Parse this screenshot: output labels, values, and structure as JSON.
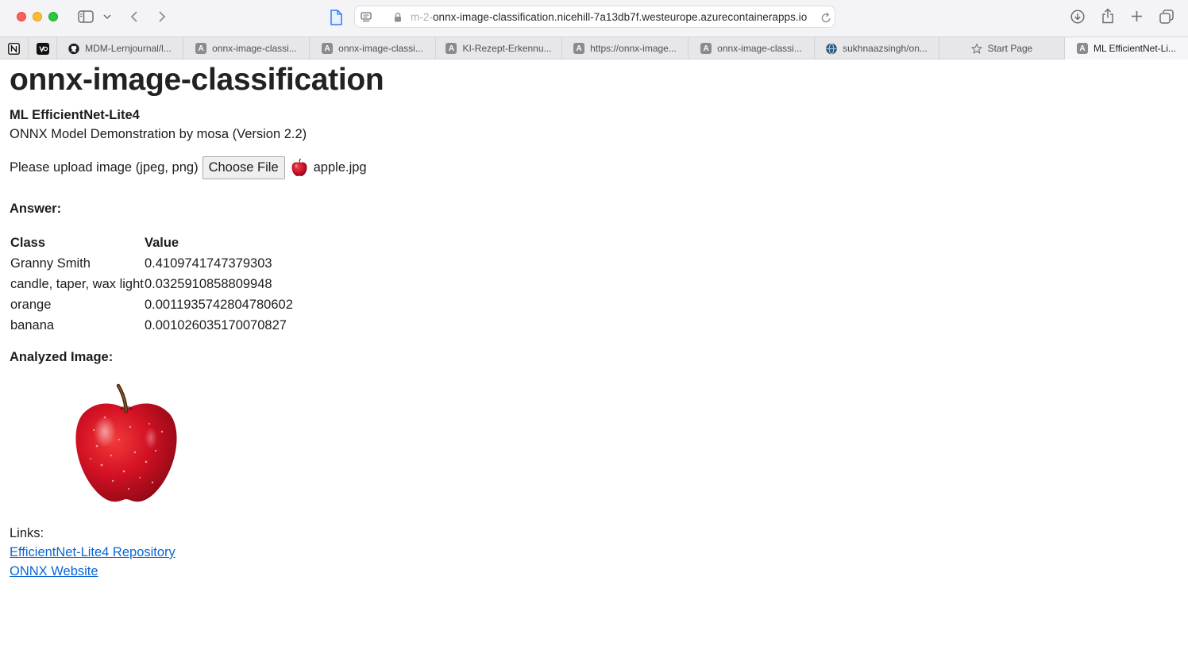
{
  "browser": {
    "url_prefix": "m-2-",
    "url": "onnx-image-classification.nicehill-7a13db7f.westeurope.azurecontainerapps.io",
    "pinned_tabs": [
      {
        "icon": "notion-icon"
      },
      {
        "icon": "vercel-icon"
      }
    ],
    "tabs": [
      {
        "label": "MDM-Lernjournal/l...",
        "icon": "github-icon"
      },
      {
        "label": "onnx-image-classi...",
        "icon": "letter-a-icon"
      },
      {
        "label": "onnx-image-classi...",
        "icon": "letter-a-icon"
      },
      {
        "label": "KI-Rezept-Erkennu...",
        "icon": "letter-a-icon"
      },
      {
        "label": "https://onnx-image...",
        "icon": "letter-a-icon"
      },
      {
        "label": "onnx-image-classi...",
        "icon": "letter-a-icon"
      },
      {
        "label": "sukhnaazsingh/on...",
        "icon": "globe-icon"
      },
      {
        "label": "Start Page",
        "icon": "star-icon"
      },
      {
        "label": "ML EfficientNet-Li...",
        "icon": "letter-a-icon",
        "active": true
      }
    ]
  },
  "page": {
    "title": "onnx-image-classification",
    "subtitle": "ML EfficientNet-Lite4",
    "demo_line": "ONNX Model Demonstration by mosa (Version 2.2)",
    "upload_label": "Please upload image (jpeg, png)",
    "choose_file_label": "Choose File",
    "file_name": "apple.jpg",
    "answer_label": "Answer:",
    "table": {
      "headers": [
        "Class",
        "Value"
      ],
      "rows": [
        [
          "Granny Smith",
          "0.4109741747379303"
        ],
        [
          "candle, taper, wax light",
          "0.0325910858809948"
        ],
        [
          "orange",
          "0.0011935742804780602"
        ],
        [
          "banana",
          "0.001026035170070827"
        ]
      ]
    },
    "analyzed_label": "Analyzed Image:",
    "links_label": "Links:",
    "links": [
      {
        "label": "EfficientNet-Lite4 Repository"
      },
      {
        "label": "ONNX Website"
      }
    ]
  },
  "colors": {
    "link": "#0b66d6",
    "apple_red": "#c8102e",
    "traffic_close": "#ff5f57",
    "traffic_min": "#febc2e",
    "traffic_max": "#28c840"
  }
}
